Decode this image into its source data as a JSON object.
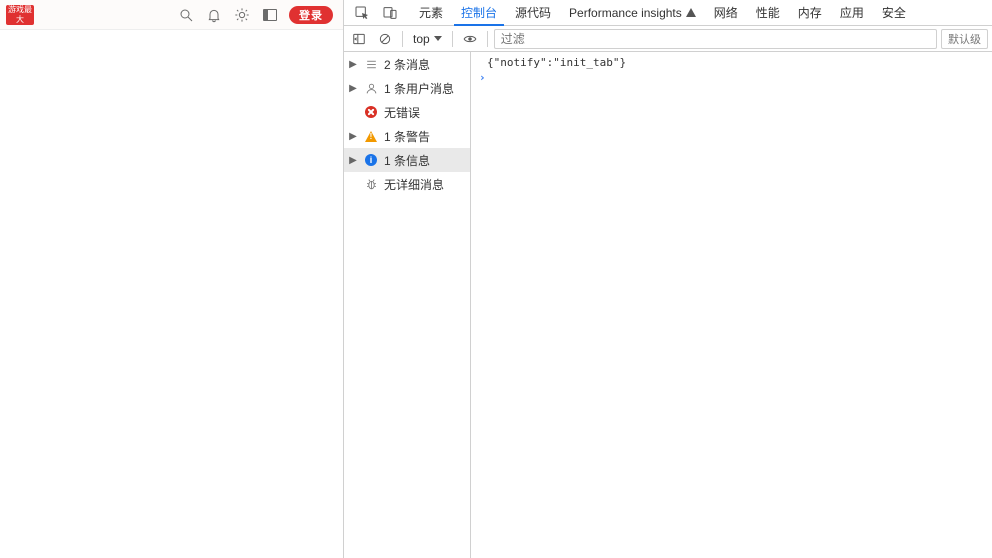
{
  "app": {
    "brand_text": "游戏最大",
    "login_label": "登录"
  },
  "devtools": {
    "tabs": {
      "elements": "元素",
      "console": "控制台",
      "sources": "源代码",
      "perf_insights": "Performance insights",
      "network": "网络",
      "performance": "性能",
      "memory": "内存",
      "application": "应用",
      "security": "安全"
    },
    "toolbar": {
      "context": "top",
      "filter_placeholder": "过滤",
      "levels_label": "默认级"
    },
    "sidebar": {
      "messages": "2 条消息",
      "user_messages": "1 条用户消息",
      "no_errors": "无错误",
      "warnings": "1 条警告",
      "info": "1 条信息",
      "no_verbose": "无详细消息"
    },
    "console": {
      "line1": "{\"notify\":\"init_tab\"}"
    }
  }
}
